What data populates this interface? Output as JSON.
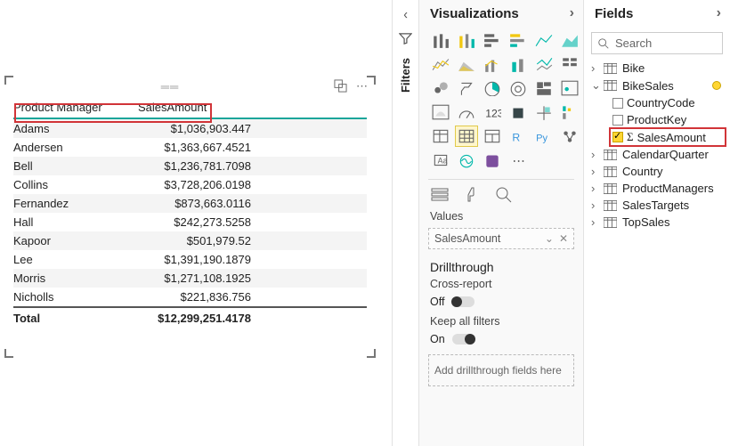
{
  "table": {
    "headers": {
      "col1": "Product Manager",
      "col2": "SalesAmount"
    },
    "rows": [
      {
        "manager": "Adams",
        "amount": "$1,036,903.447"
      },
      {
        "manager": "Andersen",
        "amount": "$1,363,667.4521"
      },
      {
        "manager": "Bell",
        "amount": "$1,236,781.7098"
      },
      {
        "manager": "Collins",
        "amount": "$3,728,206.0198"
      },
      {
        "manager": "Fernandez",
        "amount": "$873,663.0116"
      },
      {
        "manager": "Hall",
        "amount": "$242,273.5258"
      },
      {
        "manager": "Kapoor",
        "amount": "$501,979.52"
      },
      {
        "manager": "Lee",
        "amount": "$1,391,190.1879"
      },
      {
        "manager": "Morris",
        "amount": "$1,271,108.1925"
      },
      {
        "manager": "Nicholls",
        "amount": "$221,836.756"
      }
    ],
    "footer": {
      "label": "Total",
      "amount": "$12,299,251.4178"
    }
  },
  "filtersLabel": "Filters",
  "viz": {
    "title": "Visualizations",
    "valuesLabel": "Values",
    "valuesField": "SalesAmount",
    "drillTitle": "Drillthrough",
    "crossReportLabel": "Cross-report",
    "crossReportState": "Off",
    "keepFiltersLabel": "Keep all filters",
    "keepFiltersState": "On",
    "drillDropHint": "Add drillthrough fields here"
  },
  "fields": {
    "title": "Fields",
    "searchPlaceholder": "Search",
    "tables": [
      {
        "name": "Bike",
        "expanded": false
      },
      {
        "name": "BikeSales",
        "expanded": true,
        "warn": true,
        "columns": [
          {
            "name": "CountryCode",
            "checked": false
          },
          {
            "name": "ProductKey",
            "checked": false
          },
          {
            "name": "SalesAmount",
            "checked": true,
            "sigma": true,
            "highlight": true
          }
        ]
      },
      {
        "name": "CalendarQuarter",
        "expanded": false
      },
      {
        "name": "Country",
        "expanded": false
      },
      {
        "name": "ProductManagers",
        "expanded": false
      },
      {
        "name": "SalesTargets",
        "expanded": false
      },
      {
        "name": "TopSales",
        "expanded": false
      }
    ]
  }
}
